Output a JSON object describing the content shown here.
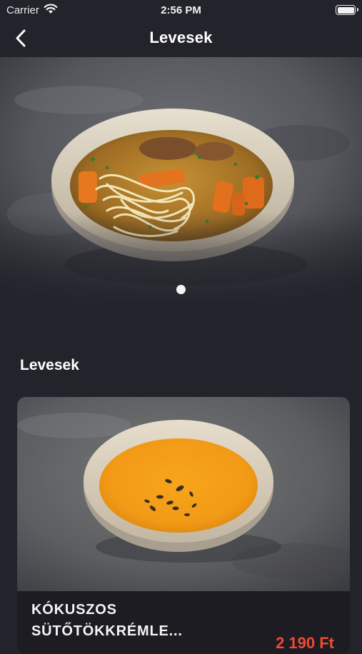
{
  "status_bar": {
    "carrier": "Carrier",
    "time": "2:56 PM"
  },
  "nav": {
    "title": "Levesek"
  },
  "hero": {
    "image": "broth-soup-with-noodles-and-carrots",
    "pages": 1,
    "active_page": 1
  },
  "section": {
    "title": "Levesek"
  },
  "products": [
    {
      "name": "KÓKUSZOS SÜTŐTÖKKRÉMLE...",
      "image": "pumpkin-cream-soup-with-seeds",
      "price": "2 190 Ft"
    }
  ],
  "colors": {
    "background": "#22232b",
    "card": "#1c1c22",
    "price": "#ee4a36",
    "text": "#ffffff"
  }
}
